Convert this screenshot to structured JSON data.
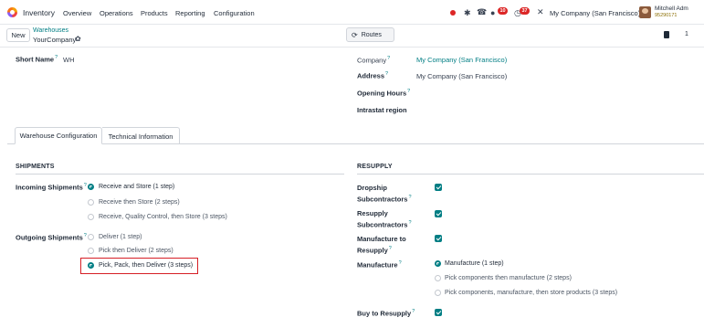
{
  "navbar": {
    "app_name": "Inventory",
    "menu": [
      "Overview",
      "Operations",
      "Products",
      "Reporting",
      "Configuration"
    ],
    "badges": {
      "messages": "10",
      "activities": "37"
    },
    "company": "My Company (San Francisco)",
    "user_name": "Mitchell Adm",
    "user_db": "95290171"
  },
  "control_panel": {
    "new_label": "New",
    "breadcrumb_parent": "Warehouses",
    "breadcrumb_current": "YourCompany",
    "routes_label": "Routes",
    "pager_extra": "1"
  },
  "form": {
    "short_name_label": "Short Name",
    "short_name_value": "WH",
    "company_label": "Company",
    "company_value": "My Company (San Francisco)",
    "address_label": "Address",
    "address_value": "My Company (San Francisco)",
    "opening_hours_label": "Opening Hours",
    "intrastat_label": "Intrastat region"
  },
  "tabs": [
    "Warehouse Configuration",
    "Technical Information"
  ],
  "shipments": {
    "title": "SHIPMENTS",
    "incoming_label": "Incoming Shipments",
    "incoming_options": [
      "Receive and Store (1 step)",
      "Receive then Store (2 steps)",
      "Receive, Quality Control, then Store (3 steps)"
    ],
    "incoming_selected": 0,
    "outgoing_label": "Outgoing Shipments",
    "outgoing_options": [
      "Deliver (1 step)",
      "Pick then Deliver (2 steps)",
      "Pick, Pack, then Deliver (3 steps)"
    ],
    "outgoing_selected": 2
  },
  "resupply": {
    "title": "RESUPPLY",
    "dropship_label_1": "Dropship",
    "dropship_label_2": "Subcontractors",
    "resupply_sub_label_1": "Resupply",
    "resupply_sub_label_2": "Subcontractors",
    "manufacture_to_resupply_label_1": "Manufacture to",
    "manufacture_to_resupply_label_2": "Resupply",
    "manufacture_label": "Manufacture",
    "manufacture_options": [
      "Manufacture (1 step)",
      "Pick components then manufacture (2 steps)",
      "Pick components, manufacture, then store products (3 steps)"
    ],
    "manufacture_selected": 0,
    "buy_to_resupply_label": "Buy to Resupply"
  },
  "colors": {
    "accent": "#017e84",
    "highlight": "#d61f26",
    "badge": "#dc2626"
  }
}
